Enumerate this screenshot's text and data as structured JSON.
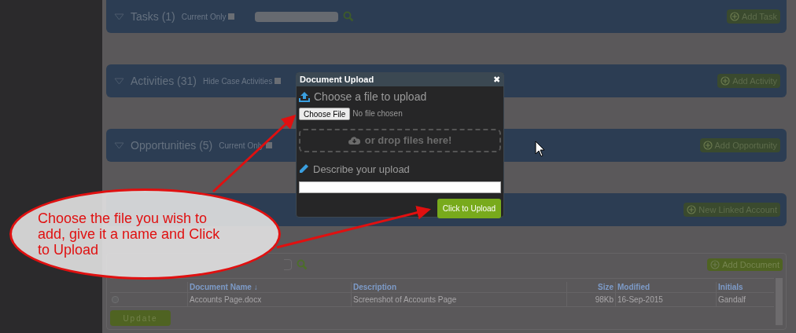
{
  "sections": [
    {
      "title": "Tasks (1)",
      "filter_label": "Current Only",
      "filter_checked": false,
      "search": true,
      "button": "Add Task"
    },
    {
      "title": "Activities (31)",
      "filter_label": "Hide Case Activities",
      "filter_checked": false,
      "search": false,
      "button": "Add Activity"
    },
    {
      "title": "Opportunities (5)",
      "filter_label": "Current Only",
      "filter_checked": false,
      "search": false,
      "button": "Add Opportunity"
    },
    {
      "search": false,
      "button": "New Linked Account"
    }
  ],
  "documents": {
    "button": "Add Document",
    "columns": [
      {
        "label": "Document Name ↓",
        "kind": "text"
      },
      {
        "label": "Description",
        "kind": "text"
      },
      {
        "label": "Size",
        "kind": "number"
      },
      {
        "label": "Modified",
        "kind": "text"
      },
      {
        "label": "Initials",
        "kind": "text"
      }
    ],
    "rows": [
      {
        "checked": false,
        "cells": [
          "Accounts Page.docx",
          "Screenshot of Accounts Page",
          "98Kb",
          "16-Sep-2015",
          "Gandalf"
        ]
      }
    ],
    "update_button": "Update"
  },
  "dialog": {
    "title": "Document Upload",
    "close": "✖",
    "choose_label": "Choose a file to upload",
    "file_button": "Choose File",
    "file_status": "No file chosen",
    "drop_text": "or drop files here!",
    "describe_label": "Describe your upload",
    "submit": "Click to Upload"
  },
  "callout": {
    "text": "Choose the file you wish to add, give it a name and Click to Upload"
  }
}
